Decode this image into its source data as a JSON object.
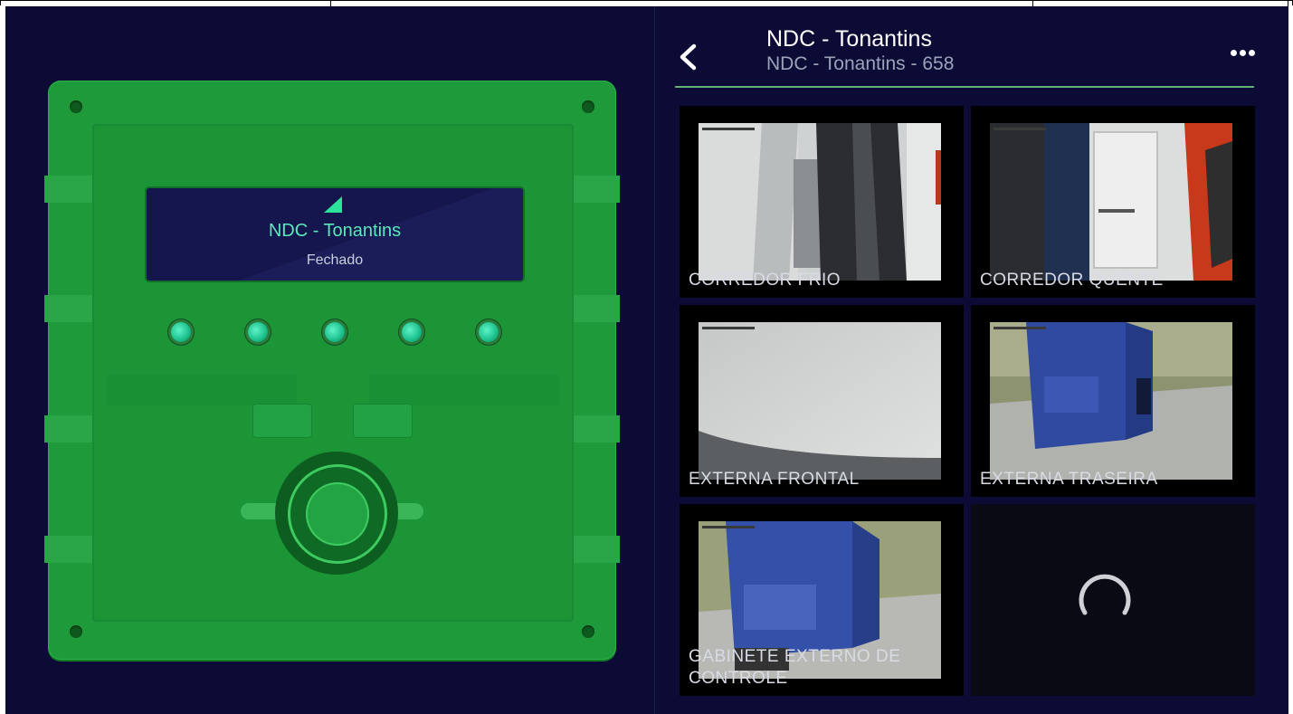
{
  "controller": {
    "display_title": "NDC - Tonantins",
    "display_status": "Fechado",
    "signal_icon": "signal-icon",
    "led_count": 5
  },
  "header": {
    "back_icon": "chevron-left-icon",
    "title": "NDC - Tonantins",
    "subtitle": "NDC - Tonantins - 658",
    "menu_icon": "more-horizontal-icon"
  },
  "cameras": [
    {
      "label": "CORREDOR FRIO"
    },
    {
      "label": "CORREDOR QUENTE"
    },
    {
      "label": "EXTERNA FRONTAL"
    },
    {
      "label": "EXTERNA TRASEIRA"
    },
    {
      "label": "GABINETE EXTERNO DE CONTROLE"
    },
    {
      "label": "",
      "loading": true
    }
  ],
  "colors": {
    "background": "#0b0b35",
    "panel": "#1f9a3a",
    "accent": "#5ce8b9",
    "header_line": "#5fae74"
  }
}
